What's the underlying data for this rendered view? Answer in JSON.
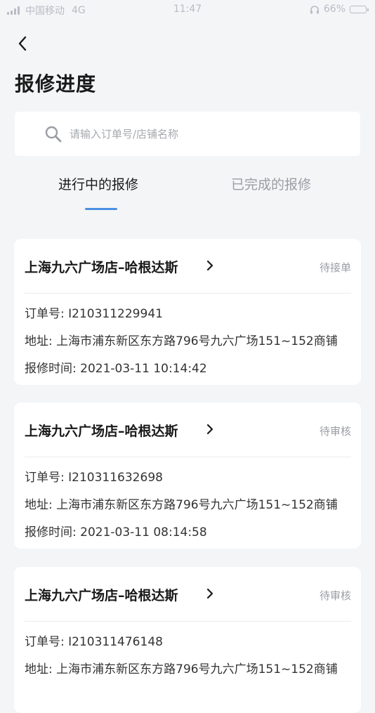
{
  "status_bar": {
    "carrier": "中国移动",
    "network": "4G",
    "time": "11:47",
    "battery": "66%",
    "battery_level": 0.66
  },
  "header": {
    "title": "报修进度"
  },
  "search": {
    "placeholder": "请输入订单号/店铺名称",
    "value": ""
  },
  "tabs": [
    {
      "label": "进行中的报修",
      "active": true
    },
    {
      "label": "已完成的报修",
      "active": false
    }
  ],
  "labels": {
    "order_prefix": "订单号: ",
    "address_prefix": "地址: ",
    "time_prefix": "报修时间: "
  },
  "orders": [
    {
      "shop": "上海九六广场店–哈根达斯",
      "status": "待接单",
      "order_no": "I210311229941",
      "address": "上海市浦东新区东方路796号九六广场151~152商铺",
      "time": "2021-03-11 10:14:42"
    },
    {
      "shop": "上海九六广场店–哈根达斯",
      "status": "待审核",
      "order_no": "I210311632698",
      "address": "上海市浦东新区东方路796号九六广场151~152商铺",
      "time": "2021-03-11 08:14:58"
    },
    {
      "shop": "上海九六广场店–哈根达斯",
      "status": "待审核",
      "order_no": "I210311476148",
      "address": "上海市浦东新区东方路796号九六广场151~152商铺",
      "time": ""
    }
  ],
  "colors": {
    "accent": "#4a90e2",
    "background": "#f4f5f7"
  }
}
